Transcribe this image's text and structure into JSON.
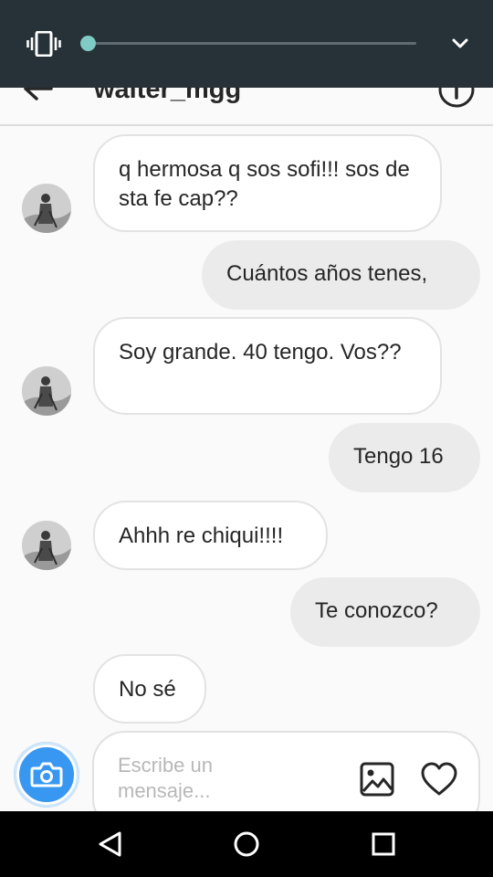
{
  "header": {
    "title": "walter_mgg",
    "back_icon": "arrow-left-icon",
    "info_icon": "info-icon"
  },
  "volume": {
    "mode_icon": "vibrate-icon",
    "level": 0.0,
    "expand_icon": "chevron-down-icon",
    "accent_color": "#80cbc4"
  },
  "messages": [
    {
      "sender": "them",
      "text": "q hermosa q sos sofi!!! sos de sta fe cap??"
    },
    {
      "sender": "me",
      "text": "Cuántos años tenes,"
    },
    {
      "sender": "them",
      "text": "Soy grande. 40 tengo. Vos??"
    },
    {
      "sender": "me",
      "text": "Tengo 16"
    },
    {
      "sender": "them",
      "text": "Ahhh re chiqui!!!!"
    },
    {
      "sender": "me",
      "text": "Te conozco?"
    },
    {
      "sender": "them",
      "text": "No sé"
    }
  ],
  "composer": {
    "placeholder": "Escribe un mensaje...",
    "camera_icon": "camera-icon",
    "gallery_icon": "image-icon",
    "like_icon": "heart-icon",
    "camera_color": "#3897f0"
  },
  "navbar": {
    "back_icon": "triangle-back-icon",
    "home_icon": "circle-home-icon",
    "recents_icon": "square-recents-icon"
  }
}
